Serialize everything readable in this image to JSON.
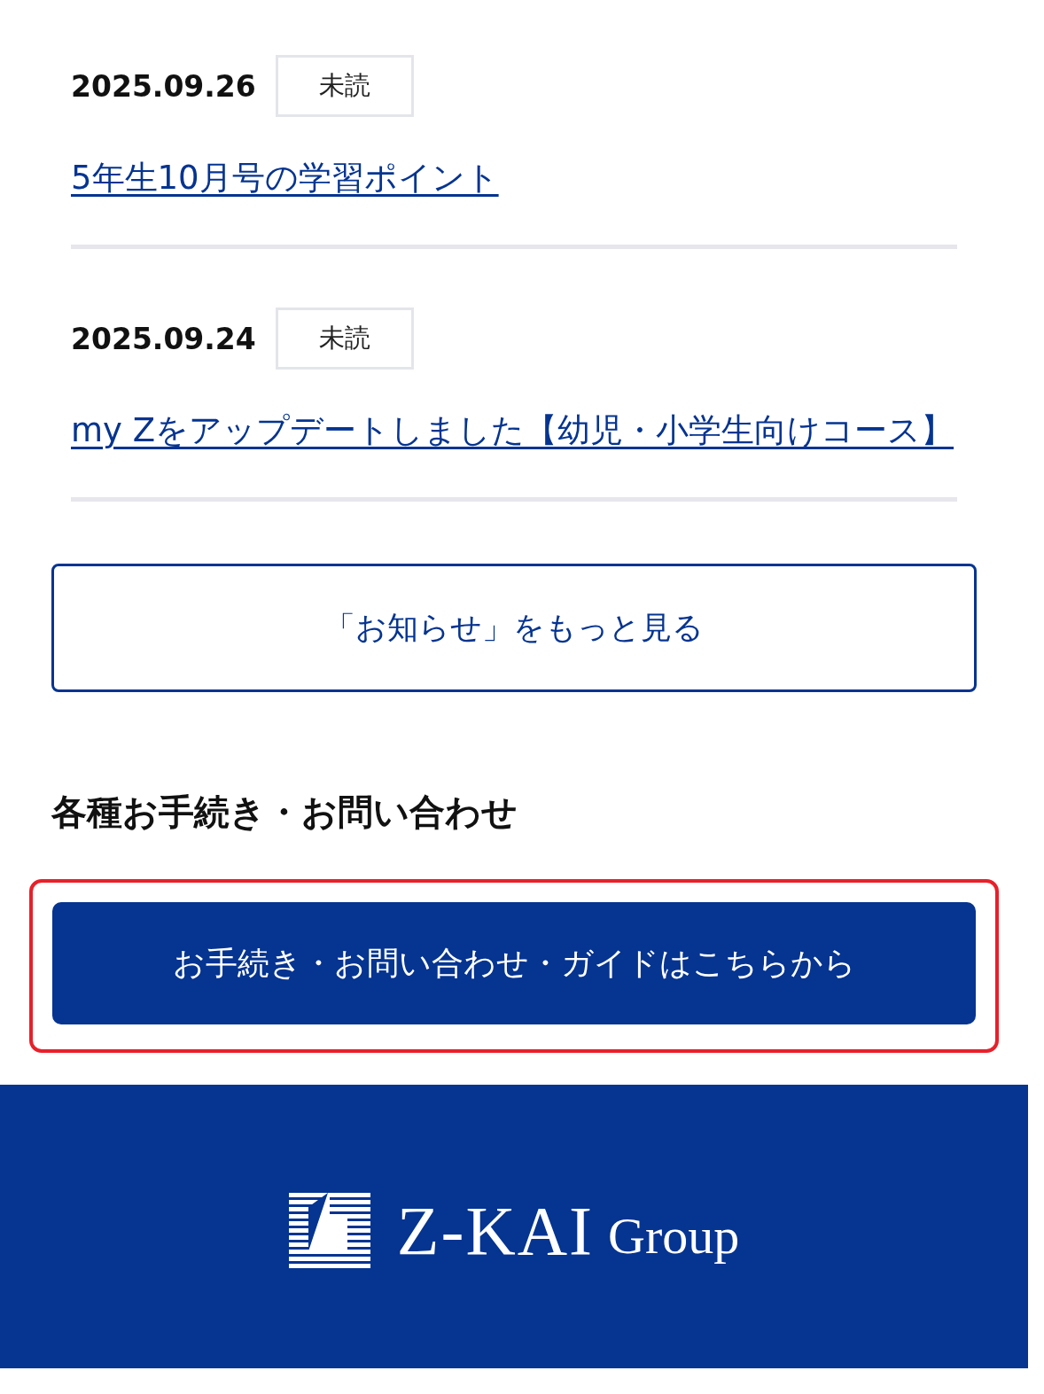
{
  "news": [
    {
      "date": "2025.09.26",
      "badge": "未読",
      "title": "5年生10月号の学習ポイント"
    },
    {
      "date": "2025.09.24",
      "badge": "未読",
      "title": "my Zをアップデートしました【幼児・小学生向けコース】"
    }
  ],
  "more_button": "「お知らせ」をもっと見る",
  "section_heading": "各種お手続き・お問い合わせ",
  "guide_button": {
    "label": "お手続き・お問い合わせ・ガイドはこちらから",
    "highlighted": true
  },
  "footer": {
    "logo_main": "Z-KAI",
    "logo_sub": "Group"
  }
}
